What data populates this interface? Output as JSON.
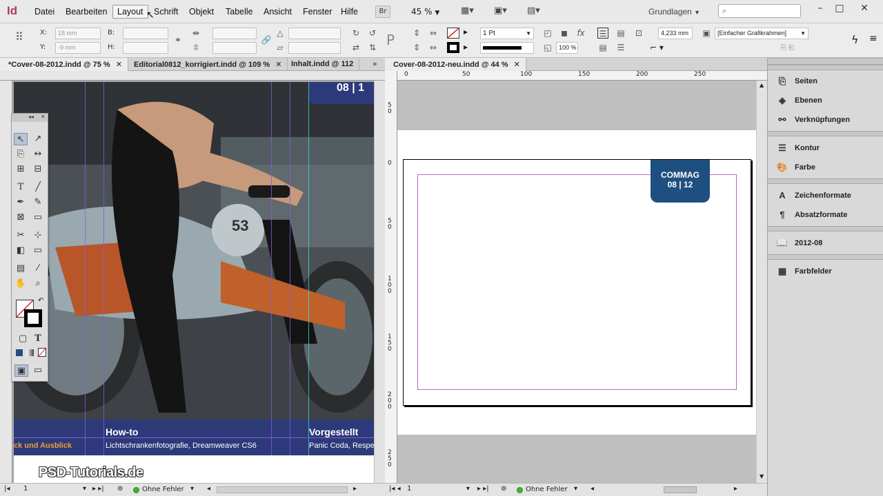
{
  "app": {
    "logo": "Id"
  },
  "menu": [
    "Datei",
    "Bearbeiten",
    "Layout",
    "Schrift",
    "Objekt",
    "Tabelle",
    "Ansicht",
    "Fenster",
    "Hilfe"
  ],
  "menu_active": "Layout",
  "toolbar": {
    "bridge": "Br",
    "zoom": "45 %",
    "workspace": "Grundlagen"
  },
  "control": {
    "x_label": "X:",
    "x_value": "18 mm",
    "y_label": "Y:",
    "y_value": "-9 mm",
    "w_label": "B:",
    "h_label": "H:",
    "stroke_weight": "1 Pt",
    "opacity": "100 %",
    "dimension": "4,233 mm",
    "frame_style": "[Einfacher Grafikrahmen]"
  },
  "tabs_left": [
    {
      "label": "*Cover-08-2012.indd @ 75 %"
    },
    {
      "label": "Editorial0812_korrigiert.indd @ 109 %"
    },
    {
      "label": "Inhalt.indd @ 112"
    }
  ],
  "tab_right": {
    "label": "Cover-08-2012-neu.indd @ 44 %"
  },
  "left_doc": {
    "top_badge": "08 | 1",
    "how_to_title": "How-to",
    "how_to_sub": "Lichtschrankenfotografie, Dreamweaver CS6",
    "vorgestellt_title": "Vorgestellt",
    "vorgestellt_sub": "Panic Coda, Respe",
    "left_sub": "ck und Ausblick",
    "logo": "PSD-Tutorials.de",
    "bike_number": "53"
  },
  "right_doc": {
    "badge_line1": "COMMAG",
    "badge_line2": "08 | 12",
    "ruler_top": [
      "0",
      "50",
      "100",
      "150",
      "200",
      "250"
    ],
    "ruler_side": [
      "5\n0",
      "0",
      "5\n0",
      "1\n0\n0",
      "1\n5\n0",
      "2\n0\n0",
      "2\n5\n0"
    ]
  },
  "side_panel": [
    {
      "label": "Seiten",
      "icon": "pages-icon"
    },
    {
      "label": "Ebenen",
      "icon": "layers-icon"
    },
    {
      "label": "Verknüpfungen",
      "icon": "links-icon"
    },
    {
      "label": "Kontur",
      "icon": "stroke-icon"
    },
    {
      "label": "Farbe",
      "icon": "color-icon"
    },
    {
      "label": "Zeichenformate",
      "icon": "character-styles-icon"
    },
    {
      "label": "Absatzformate",
      "icon": "paragraph-styles-icon"
    },
    {
      "label": "2012-08",
      "icon": "library-icon"
    },
    {
      "label": "Farbfelder",
      "icon": "swatches-icon"
    }
  ],
  "status": {
    "left_page": "1",
    "left_errors": "Ohne Fehler",
    "right_page": "1",
    "right_errors": "Ohne Fehler"
  },
  "colors": {
    "banner": "#2d3a7a",
    "badge": "#1f4f80",
    "margin": "#c062c9",
    "ok": "#3cb62f"
  }
}
